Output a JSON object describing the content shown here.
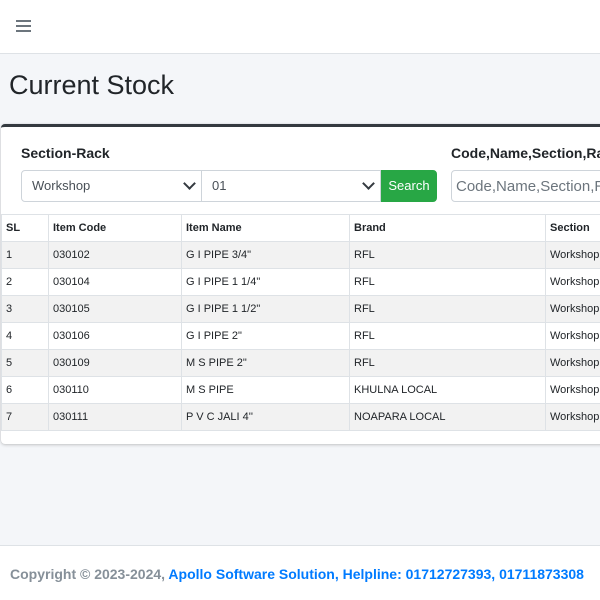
{
  "page_title": "Current Stock",
  "filters": {
    "section_rack_label": "Section-Rack",
    "section_value": "Workshop",
    "rack_value": "01",
    "search_button": "Search",
    "code_label": "Code,Name,Section,Rack",
    "code_placeholder": "Code,Name,Section,Rack"
  },
  "table": {
    "headers": [
      "SL",
      "Item Code",
      "Item Name",
      "Brand",
      "Section"
    ],
    "rows": [
      [
        "1",
        "030102",
        "G I PIPE 3/4\"",
        "RFL",
        "Workshop"
      ],
      [
        "2",
        "030104",
        "G I PIPE 1 1/4\"",
        "RFL",
        "Workshop"
      ],
      [
        "3",
        "030105",
        "G I PIPE 1 1/2\"",
        "RFL",
        "Workshop"
      ],
      [
        "4",
        "030106",
        "G I PIPE 2\"",
        "RFL",
        "Workshop"
      ],
      [
        "5",
        "030109",
        "M S PIPE 2\"",
        "RFL",
        "Workshop"
      ],
      [
        "6",
        "030110",
        "M S PIPE",
        "KHULNA LOCAL",
        "Workshop"
      ],
      [
        "7",
        "030111",
        "P V C JALI 4''",
        "NOAPARA LOCAL",
        "Workshop"
      ]
    ]
  },
  "footer": {
    "copyright": "Copyright © 2023-2024, ",
    "link_text": "Apollo Software Solution, Helpline: 01712727393, 01711873308"
  },
  "icons": {
    "menu": "hamburger-menu-icon",
    "select_caret": "chevron-down-icon"
  },
  "colors": {
    "accent_green": "#28a745",
    "link_blue": "#007bff",
    "card_top_border": "#343a40"
  }
}
